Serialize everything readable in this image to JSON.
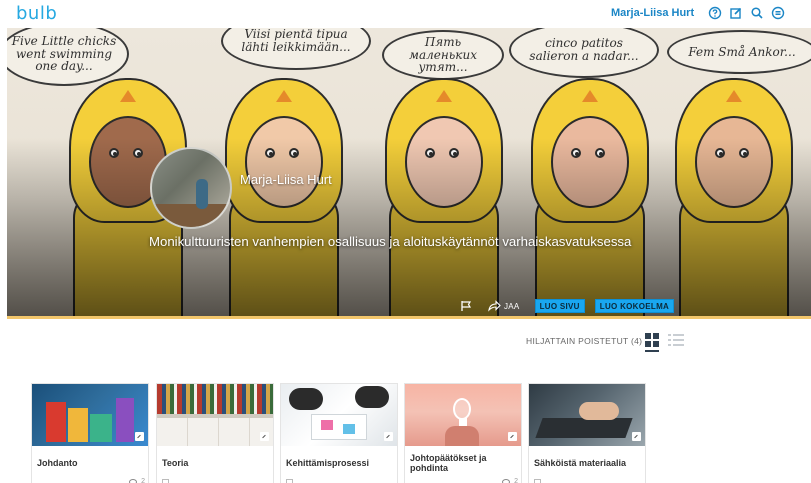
{
  "header": {
    "logo": "bulb",
    "user_name": "Marja-Liisa Hurt",
    "icons": [
      "help-icon",
      "edit-icon",
      "search-icon",
      "menu-icon"
    ]
  },
  "hero": {
    "bubbles": [
      "Five Little chicks went swimming one day...",
      "Viisi pientä tipua lähti leikkimään...",
      "Пять маленьких утят...",
      "cinco patitos salieron a nadar...",
      "Fem Små Ankor..."
    ],
    "owner_name": "Marja-Liisa Hurt",
    "portfolio_title": "Monikulttuuristen vanhempien osallisuus ja aloituskäytännöt varhaiskasvatuksessa",
    "share_label": "JAA",
    "create_page_label": "LUO SIVU",
    "create_collection_label": "LUO KOKOELMA"
  },
  "toolbar": {
    "recently_deleted": "HILJATTAIN POISTETUT (4)"
  },
  "cards": [
    {
      "title": "Johdanto",
      "views": "2"
    },
    {
      "title": "Teoria",
      "views": ""
    },
    {
      "title": "Kehittämisprosessi",
      "views": ""
    },
    {
      "title": "Johtopäätökset ja pohdinta",
      "views": "2"
    },
    {
      "title": "Sähköistä materiaalia",
      "views": ""
    }
  ],
  "colors": {
    "accent": "#27a9e1",
    "button": "#19a7f0",
    "chick_yellow": "#f4cf3a",
    "divider": "#f2c66b"
  }
}
